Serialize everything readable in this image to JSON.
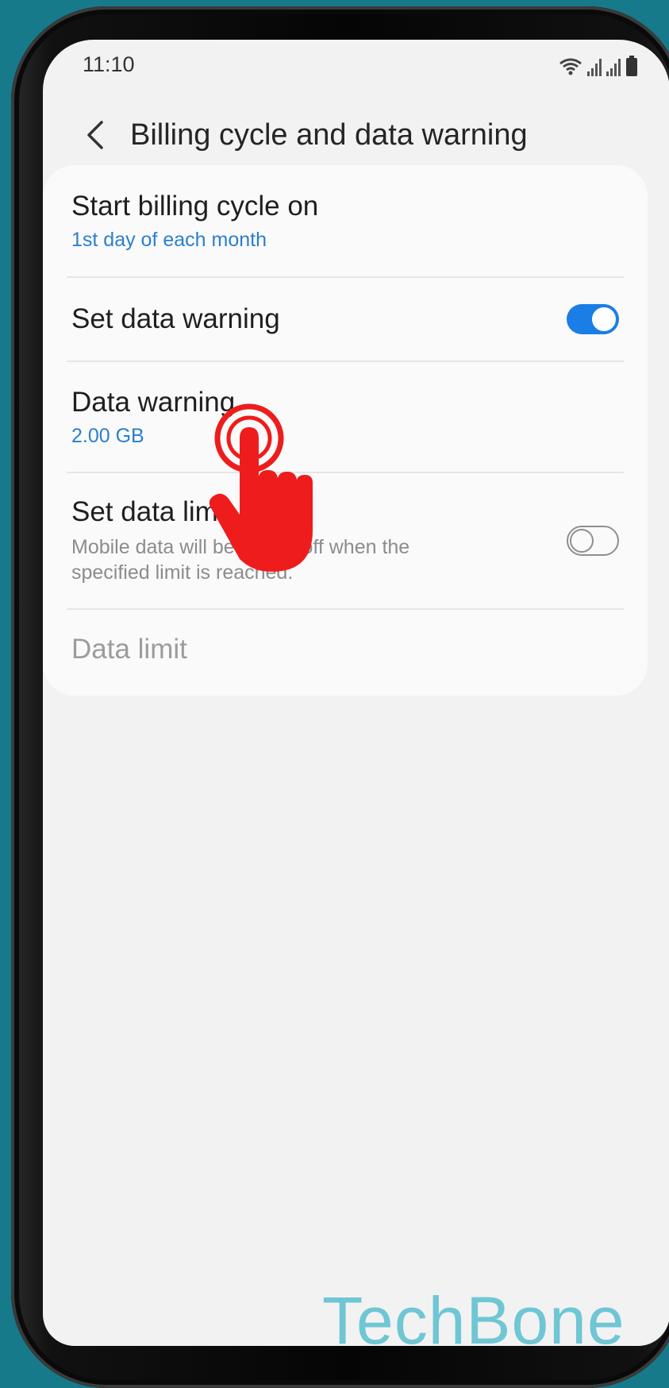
{
  "status": {
    "time": "11:10"
  },
  "header": {
    "title": "Billing cycle and data warning"
  },
  "settings": {
    "billing": {
      "title": "Start billing cycle on",
      "value": "1st day of each month"
    },
    "set_warning": {
      "title": "Set data warning",
      "enabled": true
    },
    "warning": {
      "title": "Data warning",
      "value": "2.00 GB"
    },
    "set_limit": {
      "title": "Set data limit",
      "description": "Mobile data will be turned off when the specified limit is reached.",
      "enabled": false
    },
    "limit": {
      "title": "Data limit"
    }
  },
  "colors": {
    "accent": "#1a7ee6",
    "link": "#2a7fd0",
    "tap_marker": "#ee1c1c",
    "background": "#167a8b"
  },
  "watermark": "TechBone"
}
